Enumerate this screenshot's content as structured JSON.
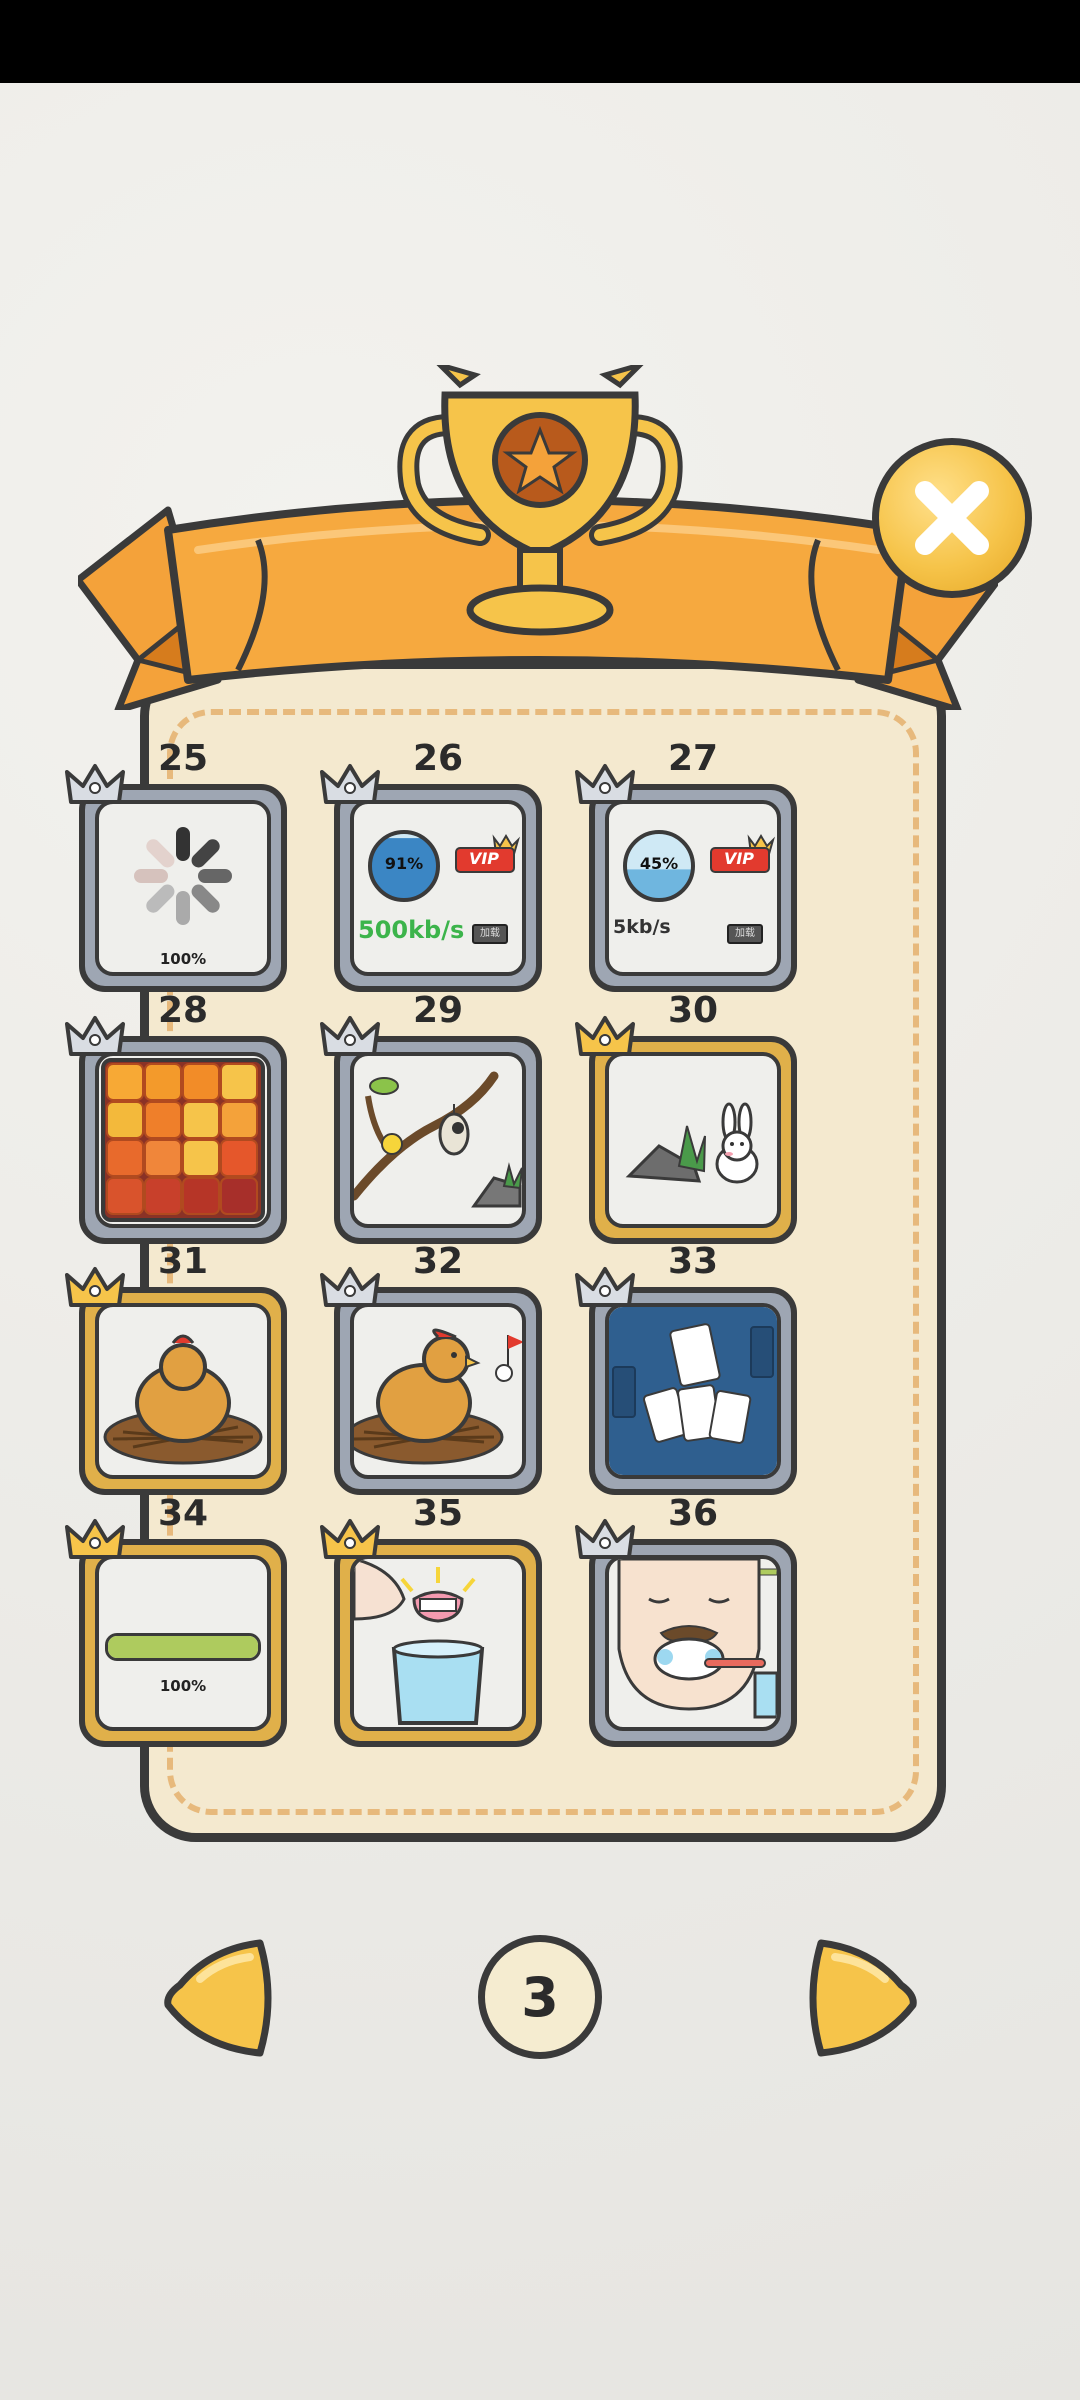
{
  "levels": [
    {
      "number": "25",
      "frame": "silver",
      "caption": "100%"
    },
    {
      "number": "26",
      "frame": "silver",
      "percent": "91%",
      "speed": "500kb/s",
      "badge": "VIP",
      "small": "加载"
    },
    {
      "number": "27",
      "frame": "silver",
      "percent": "45%",
      "speed": "5kb/s",
      "badge": "VIP",
      "small": "加载"
    },
    {
      "number": "28",
      "frame": "silver"
    },
    {
      "number": "29",
      "frame": "silver"
    },
    {
      "number": "30",
      "frame": "gold"
    },
    {
      "number": "31",
      "frame": "gold"
    },
    {
      "number": "32",
      "frame": "silver"
    },
    {
      "number": "33",
      "frame": "silver"
    },
    {
      "number": "34",
      "frame": "gold",
      "caption": "100%"
    },
    {
      "number": "35",
      "frame": "gold"
    },
    {
      "number": "36",
      "frame": "silver"
    }
  ],
  "pagination": {
    "current_page": "3"
  },
  "colors": {
    "accent_orange": "#f4a23a",
    "gold": "#f6c44a",
    "panel": "#f4e9cf",
    "green_text": "#3cb44b"
  },
  "icons": {
    "close": "close-icon",
    "trophy": "trophy-icon",
    "prev": "prev-arrow-icon",
    "next": "next-arrow-icon"
  }
}
